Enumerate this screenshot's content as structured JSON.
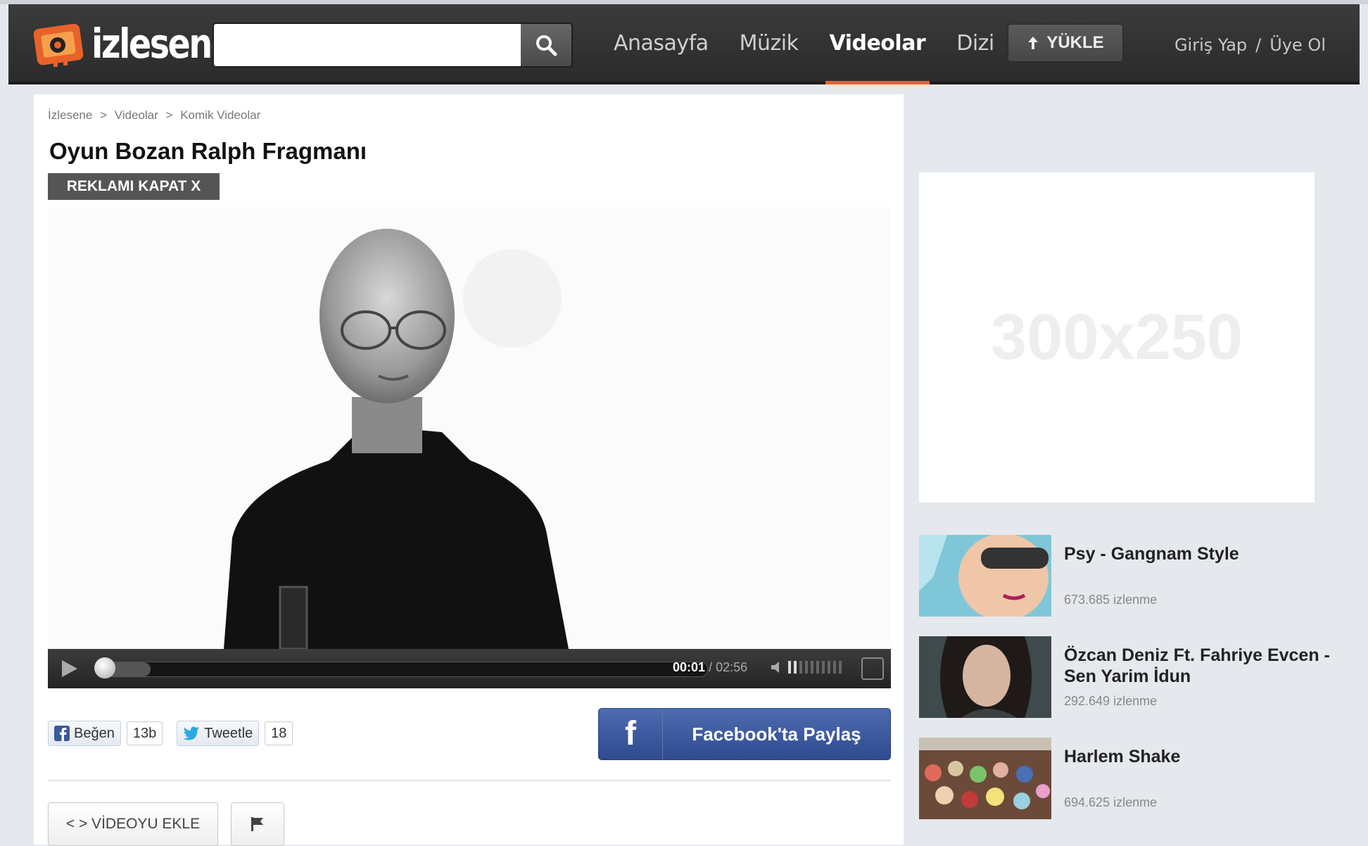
{
  "header": {
    "logo_text": "izlesene",
    "search_placeholder": "",
    "nav": [
      "Anasayfa",
      "Müzik",
      "Videolar",
      "Dizi"
    ],
    "upload_label": "YÜKLE",
    "login_label": "Giriş Yap",
    "login_sep": "/",
    "signup_label": "Üye Ol"
  },
  "breadcrumb": [
    "İzlesene",
    ">",
    "Videolar",
    ">",
    "Komik Videolar"
  ],
  "video": {
    "title": "Oyun Bozan Ralph Fragmanı",
    "close_ad": "REKLAMI KAPAT X",
    "current_time": "00:01",
    "sep": "/",
    "total_time": "02:56",
    "progress": 0.08
  },
  "social": {
    "like_label": "Beğen",
    "like_count": "13b",
    "tweet_label": "Tweetle",
    "tweet_count": "18",
    "fb_share_label": "Facebook'ta Paylaş"
  },
  "actions": {
    "embed_label": "< > VİDEOYU EKLE"
  },
  "ad": {
    "size_label": "300x250"
  },
  "sidebar": {
    "items": [
      {
        "title": "Psy - Gangnam Style",
        "views": "673.685 izlenme"
      },
      {
        "title": "Özcan Deniz Ft. Fahriye Evcen - Sen Yarim İdun",
        "views": "292.649 izlenme"
      },
      {
        "title": "Harlem Shake",
        "views": "694.625 izlenme"
      }
    ]
  },
  "colors": {
    "accent": "#e8622a",
    "facebook": "#3b5998"
  }
}
